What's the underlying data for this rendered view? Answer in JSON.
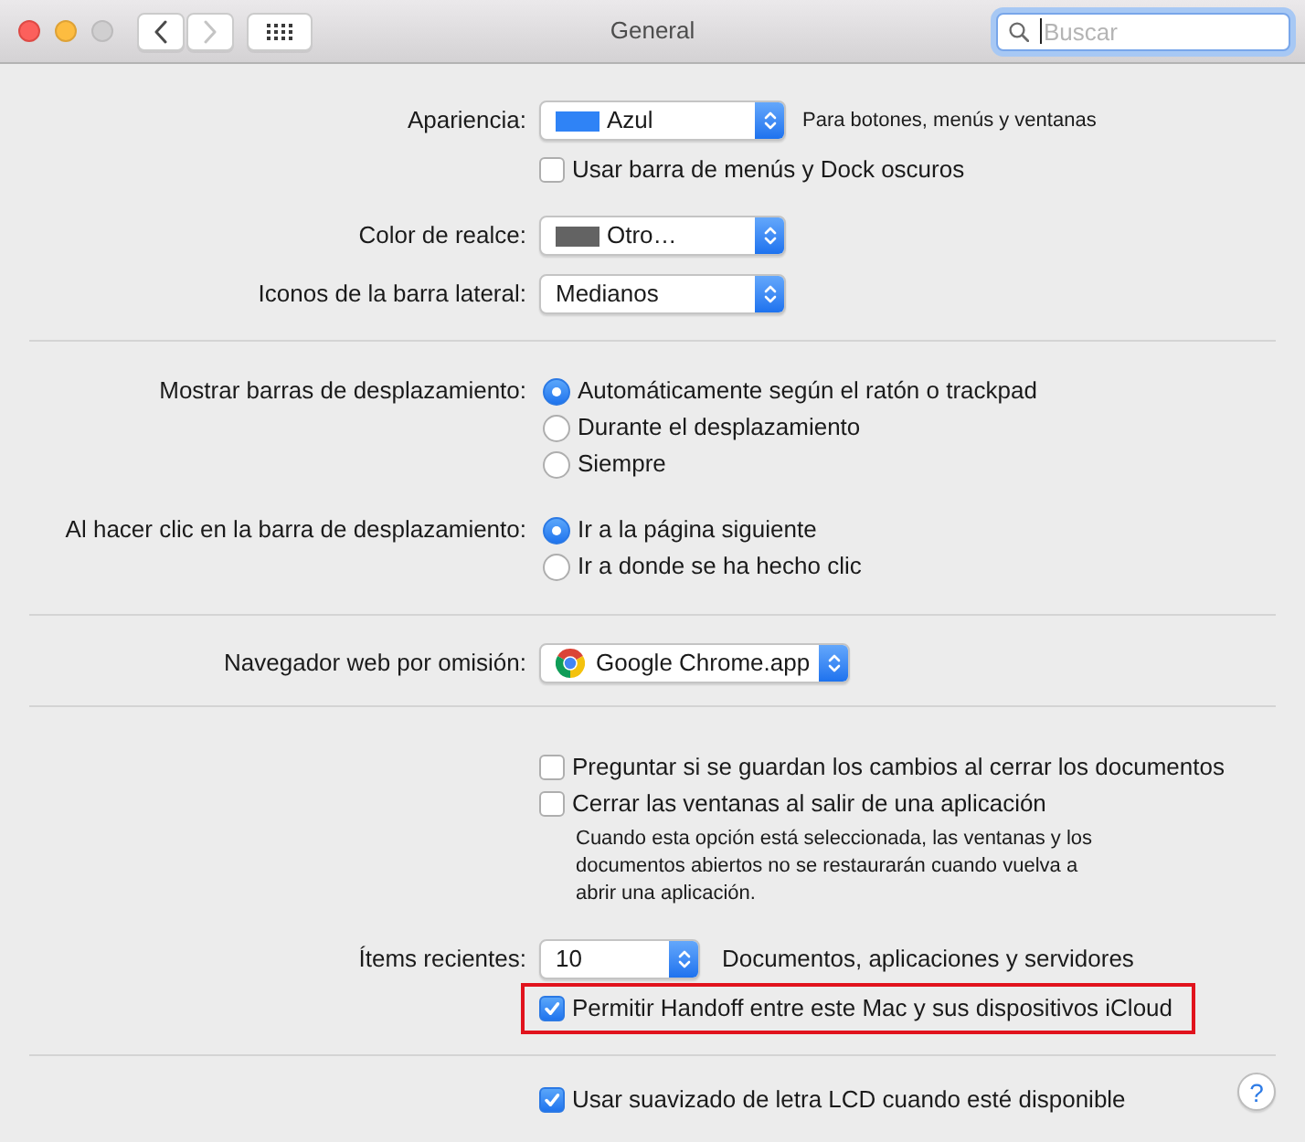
{
  "window": {
    "title": "General",
    "traffic_lights": [
      {
        "kind": "close",
        "disabled": false
      },
      {
        "kind": "minimize",
        "disabled": false
      },
      {
        "kind": "zoom",
        "disabled": true
      }
    ],
    "nav_buttons": [
      {
        "kind": "back",
        "disabled": false
      },
      {
        "kind": "forward",
        "disabled": true
      }
    ],
    "search": {
      "placeholder": "Buscar"
    }
  },
  "sections": [
    {
      "groups": [
        {
          "rows": [
            {
              "kind": "popup",
              "label": "Apariencia:",
              "value": "Azul",
              "color": "#2f83f6",
              "hint": "Para botones, menús y ventanas"
            },
            {
              "kind": "checkbox",
              "label": "Usar barra de menús y Dock oscuros",
              "checked": false,
              "highlighted": false
            }
          ]
        },
        {
          "rows": [
            {
              "kind": "popup",
              "label": "Color de realce:",
              "value": "Otro…",
              "color": "#636363"
            },
            {
              "kind": "popup",
              "label": "Iconos de la barra lateral:",
              "value": "Medianos"
            }
          ]
        }
      ]
    },
    {
      "groups": [
        {
          "rows": [
            {
              "kind": "radio",
              "label": "Mostrar barras de desplazamiento:",
              "options": [
                {
                  "label": "Automáticamente según el ratón o trackpad",
                  "selected": true
                },
                {
                  "label": "Durante el desplazamiento",
                  "selected": false
                },
                {
                  "label": "Siempre",
                  "selected": false
                }
              ]
            }
          ]
        },
        {
          "rows": [
            {
              "kind": "radio",
              "label": "Al hacer clic en la barra de desplazamiento:",
              "options": [
                {
                  "label": "Ir a la página siguiente",
                  "selected": true
                },
                {
                  "label": "Ir a donde se ha hecho clic",
                  "selected": false
                }
              ]
            }
          ]
        }
      ]
    },
    {
      "groups": [
        {
          "rows": [
            {
              "kind": "app_popup",
              "label": "Navegador web por omisión:",
              "value": "Google Chrome.app"
            }
          ]
        }
      ]
    },
    {
      "groups": [
        {
          "rows": [
            {
              "kind": "checkbox",
              "label": "Preguntar si se guardan los cambios al cerrar los documentos",
              "checked": false,
              "highlighted": false
            },
            {
              "kind": "checkbox",
              "label": "Cerrar las ventanas al salir de una aplicación",
              "checked": false,
              "highlighted": false,
              "description": "Cuando esta opción está seleccionada, las ventanas y los documentos abiertos no se restaurarán cuando vuelva a abrir una aplicación."
            }
          ]
        },
        {
          "rows": [
            {
              "kind": "popup",
              "label": "Ítems recientes:",
              "value": "10",
              "suffix": "Documentos, aplicaciones y servidores"
            },
            {
              "kind": "checkbox",
              "label": "Permitir Handoff entre este Mac y sus dispositivos iCloud",
              "checked": true,
              "highlighted": true
            }
          ]
        }
      ]
    },
    {
      "groups": [
        {
          "rows": [
            {
              "kind": "checkbox",
              "label": "Usar suavizado de letra LCD cuando esté disponible",
              "checked": true,
              "highlighted": false
            }
          ]
        }
      ],
      "help_button": {
        "label": "?"
      }
    }
  ]
}
